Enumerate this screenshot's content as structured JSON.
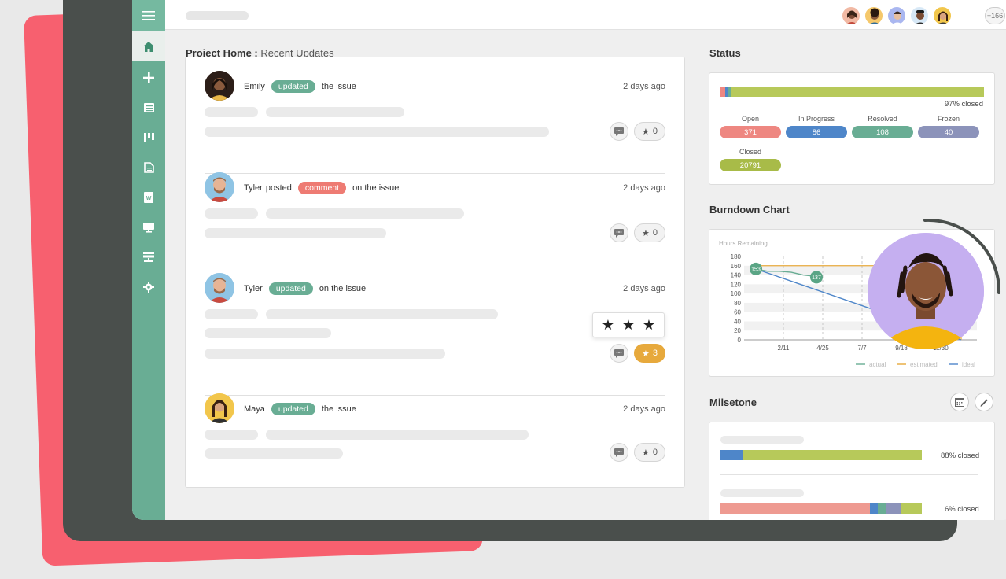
{
  "header": {
    "extra_members": "+166"
  },
  "sidebar": {
    "items": [
      "menu-icon",
      "home-icon",
      "plus-icon",
      "list-icon",
      "board-icon",
      "docs-icon",
      "word-icon",
      "monitor-icon",
      "server-icon",
      "gear-icon"
    ]
  },
  "feed": {
    "title": "Project Home :",
    "subtitle": "Recent Updates",
    "items": [
      {
        "user": "Emily",
        "action": "updated",
        "suffix": "the issue",
        "time": "2 days ago",
        "stars": "0"
      },
      {
        "user": "Tyler",
        "verb": "posted",
        "action": "comment",
        "suffix": "on the issue",
        "time": "2 days ago",
        "stars": "0"
      },
      {
        "user": "Tyler",
        "action": "updated",
        "suffix": "on the issue",
        "time": "2 days ago",
        "stars": "3"
      },
      {
        "user": "Maya",
        "action": "updated",
        "suffix": "the issue",
        "time": "2 days ago",
        "stars": "0"
      }
    ]
  },
  "status": {
    "title": "Status",
    "closed_pct": "97% closed",
    "counts": [
      {
        "label": "Open",
        "value": "371",
        "color": "#ee8781"
      },
      {
        "label": "In Progress",
        "value": "86",
        "color": "#4e86c9"
      },
      {
        "label": "Resolved",
        "value": "108",
        "color": "#69ad94"
      },
      {
        "label": "Frozen",
        "value": "40",
        "color": "#8c93ba"
      },
      {
        "label": "Closed",
        "value": "20791",
        "color": "#a8bb48"
      }
    ]
  },
  "burndown": {
    "title": "Burndown Chart",
    "ylabel": "Hours Remaining",
    "legend": [
      "actual",
      "estimated",
      "ideal"
    ],
    "marker_start": "153",
    "marker_current": "137"
  },
  "chart_data": {
    "type": "line",
    "title": "Burndown Chart",
    "ylabel": "Hours Remaining",
    "ylim": [
      0,
      180
    ],
    "yticks": [
      0,
      20,
      40,
      60,
      80,
      100,
      120,
      140,
      160,
      180
    ],
    "xticks": [
      "2/11",
      "4/25",
      "7/7",
      "9/18",
      "11/30"
    ],
    "series": [
      {
        "name": "actual",
        "color": "#69ad94",
        "values": [
          153,
          148,
          148,
          146,
          140,
          137
        ]
      },
      {
        "name": "estimated",
        "color": "#e7a93c",
        "values": [
          160,
          160,
          160,
          160,
          160,
          160
        ]
      },
      {
        "name": "ideal",
        "color": "#4e86c9",
        "values": [
          153,
          0
        ]
      }
    ]
  },
  "milestone": {
    "title": "Milsetone",
    "items": [
      {
        "pct": "88% closed"
      },
      {
        "pct": "6% closed"
      }
    ]
  }
}
